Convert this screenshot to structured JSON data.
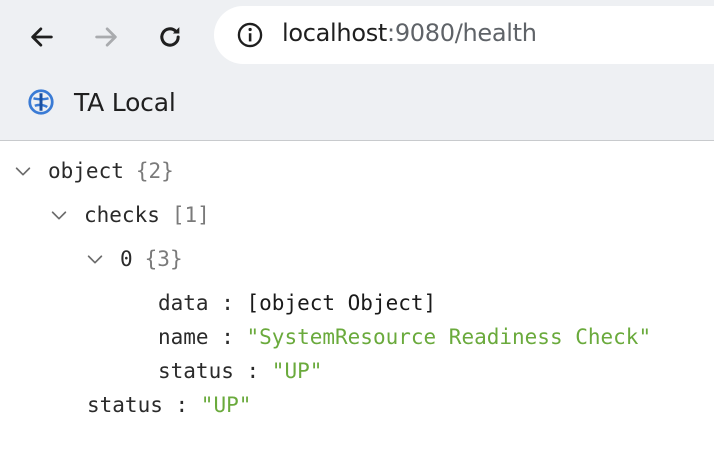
{
  "browser": {
    "url_host": "localhost",
    "url_rest": ":9080/health",
    "bookmark_label": "TA Local",
    "icons": [
      "back-arrow-icon",
      "forward-arrow-icon",
      "reload-icon",
      "info-icon",
      "bookmark-favicon-icon"
    ]
  },
  "json_tree": {
    "root": {
      "key": "object",
      "count": "{2}"
    },
    "checks": {
      "key": "checks",
      "count": "[1]"
    },
    "item0": {
      "key": "0",
      "count": "{3}"
    },
    "item_fields": [
      {
        "key": "data",
        "value": "[object Object]"
      },
      {
        "key": "name",
        "value": "\"SystemResource Readiness Check\""
      },
      {
        "key": "status",
        "value": "\"UP\""
      }
    ],
    "status": {
      "key": "status",
      "value": "\"UP\""
    }
  },
  "colors": {
    "string_value": "#6aaa3c",
    "chrome_bg": "#eef0f3"
  }
}
